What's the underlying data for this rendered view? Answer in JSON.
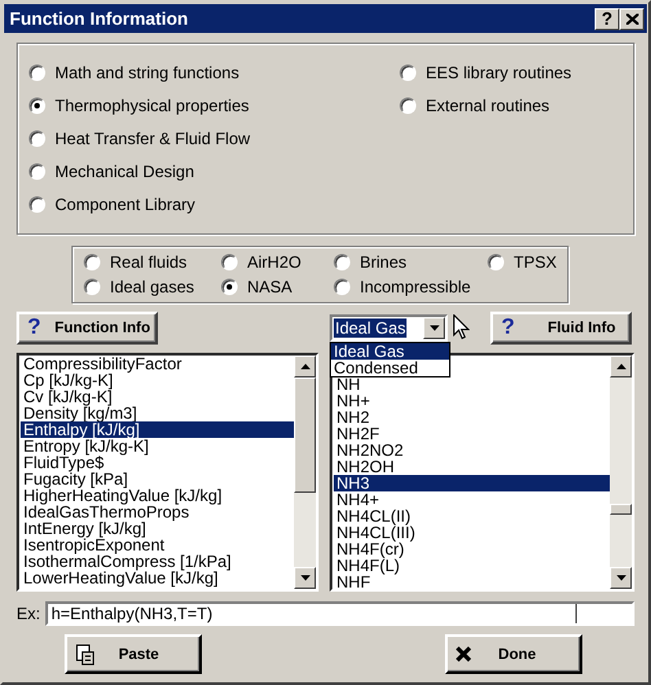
{
  "window": {
    "title": "Function Information",
    "help_button": "?"
  },
  "categories": [
    [
      {
        "label": "Math and string functions",
        "selected": false
      },
      {
        "label": "Thermophysical properties",
        "selected": true
      },
      {
        "label": "Heat Transfer & Fluid Flow",
        "selected": false
      },
      {
        "label": "Mechanical Design",
        "selected": false
      },
      {
        "label": "Component Library",
        "selected": false
      }
    ],
    [
      {
        "label": "EES library routines",
        "selected": false
      },
      {
        "label": "External routines",
        "selected": false
      }
    ]
  ],
  "fluid_types": [
    {
      "label": "Real fluids",
      "selected": false
    },
    {
      "label": "AirH2O",
      "selected": false
    },
    {
      "label": "Brines",
      "selected": false
    },
    {
      "label": "TPSX",
      "selected": false
    },
    {
      "label": "Ideal gases",
      "selected": false
    },
    {
      "label": "NASA",
      "selected": true
    },
    {
      "label": "Incompressible",
      "selected": false
    }
  ],
  "function_info_button": {
    "icon": "?",
    "label": "Function Info"
  },
  "phase_combo": {
    "value": "Ideal Gas",
    "expanded": true,
    "options": [
      {
        "label": "Ideal Gas",
        "selected": true
      },
      {
        "label": "Condensed",
        "selected": false
      }
    ]
  },
  "fluid_info_button": {
    "icon": "?",
    "label": "Fluid Info"
  },
  "functions": [
    {
      "label": "CompressibilityFactor",
      "selected": false
    },
    {
      "label": "Cp [kJ/kg-K]",
      "selected": false
    },
    {
      "label": "Cv [kJ/kg-K]",
      "selected": false
    },
    {
      "label": "Density [kg/m3]",
      "selected": false
    },
    {
      "label": "Enthalpy [kJ/kg]",
      "selected": true
    },
    {
      "label": "Entropy [kJ/kg-K]",
      "selected": false
    },
    {
      "label": "FluidType$",
      "selected": false
    },
    {
      "label": "Fugacity [kPa]",
      "selected": false
    },
    {
      "label": "HigherHeatingValue [kJ/kg]",
      "selected": false
    },
    {
      "label": "IdealGasThermoProps",
      "selected": false
    },
    {
      "label": "IntEnergy [kJ/kg]",
      "selected": false
    },
    {
      "label": "IsentropicExponent",
      "selected": false
    },
    {
      "label": "IsothermalCompress [1/kPa]",
      "selected": false
    },
    {
      "label": "LowerHeatingValue [kJ/kg]",
      "selected": false
    }
  ],
  "fluids": [
    {
      "label": "NH",
      "selected": false
    },
    {
      "label": "NH+",
      "selected": false
    },
    {
      "label": "NH2",
      "selected": false
    },
    {
      "label": "NH2F",
      "selected": false
    },
    {
      "label": "NH2NO2",
      "selected": false
    },
    {
      "label": "NH2OH",
      "selected": false
    },
    {
      "label": "NH3",
      "selected": true
    },
    {
      "label": "NH4+",
      "selected": false
    },
    {
      "label": "NH4CL(II)",
      "selected": false
    },
    {
      "label": "NH4CL(III)",
      "selected": false
    },
    {
      "label": "NH4F(cr)",
      "selected": false
    },
    {
      "label": "NH4F(L)",
      "selected": false
    },
    {
      "label": "NHF",
      "selected": false
    }
  ],
  "example": {
    "label": "Ex:",
    "value": "h=Enthalpy(NH3,T=T)"
  },
  "paste_button": {
    "label": "Paste"
  },
  "done_button": {
    "label": "Done"
  }
}
